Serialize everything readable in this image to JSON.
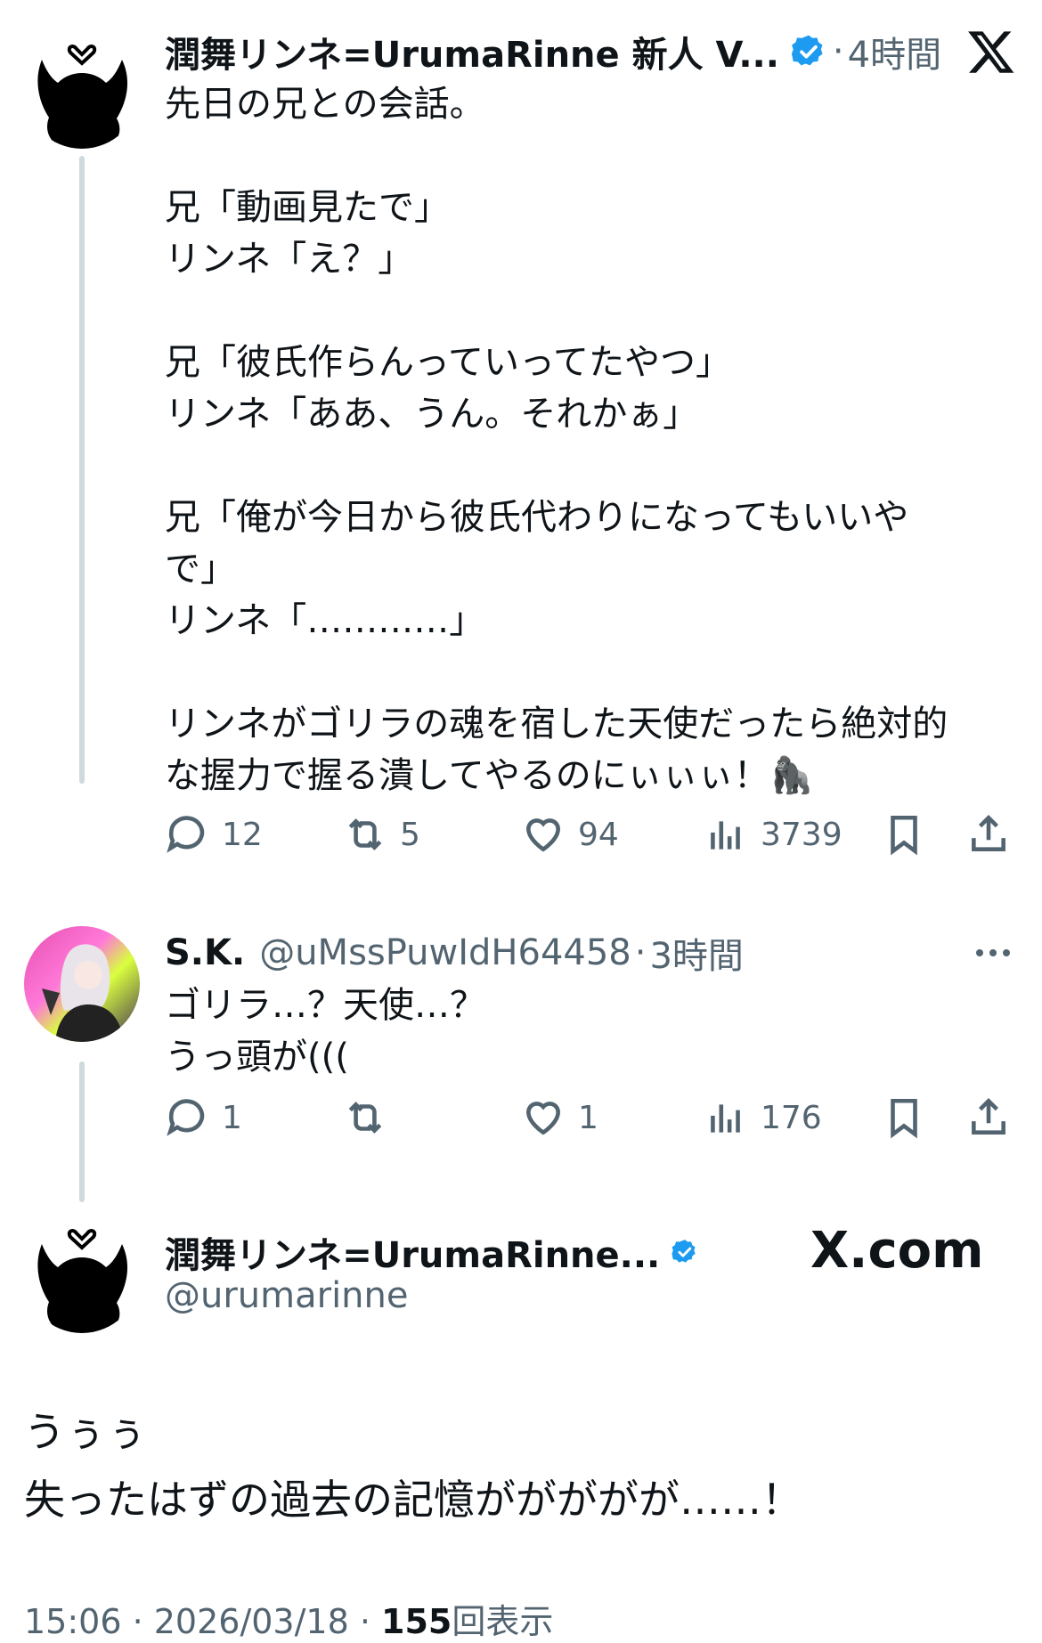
{
  "tweets": [
    {
      "display_name": "潤舞リンネ=UrumaRinne 新人 V...",
      "time": "4時間",
      "text": "先日の兄との会話。\n\n兄「動画見たで」\nリンネ「え？」\n\n兄「彼氏作らんっていってたやつ」\nリンネ「ああ、うん。それかぁ」\n\n兄「俺が今日から彼氏代わりになってもいいや\nで」\nリンネ「…………」\n\nリンネがゴリラの魂を宿した天使だったら絶対的\nな握力で握る潰してやるのにぃぃぃ！🦍",
      "replies": "12",
      "reposts": "5",
      "likes": "94",
      "views": "3739"
    },
    {
      "display_name": "S.K.",
      "handle": "@uMssPuwIdH64458",
      "time": "3時間",
      "text": "ゴリラ…？天使…？\nうっ頭が(((",
      "replies": "1",
      "reposts": "",
      "likes": "1",
      "views": "176"
    }
  ],
  "main_tweet": {
    "display_name": "潤舞リンネ=UrumaRinne...",
    "handle": "@urumarinne",
    "watermark": "X.com",
    "text": "うぅぅ\n失ったはずの過去の記憶ががががが……！",
    "timestamp": "15:06 · 2026/03/18 · ",
    "views_count": "155",
    "views_label": "回表示"
  },
  "colors": {
    "accent": "#1d9bf0",
    "secondary": "#536471",
    "line": "#cfd9de"
  },
  "icons": [
    "x-logo-icon",
    "verified-badge-icon",
    "reply-icon",
    "repost-icon",
    "like-icon",
    "views-icon",
    "bookmark-icon",
    "share-icon",
    "more-icon"
  ]
}
